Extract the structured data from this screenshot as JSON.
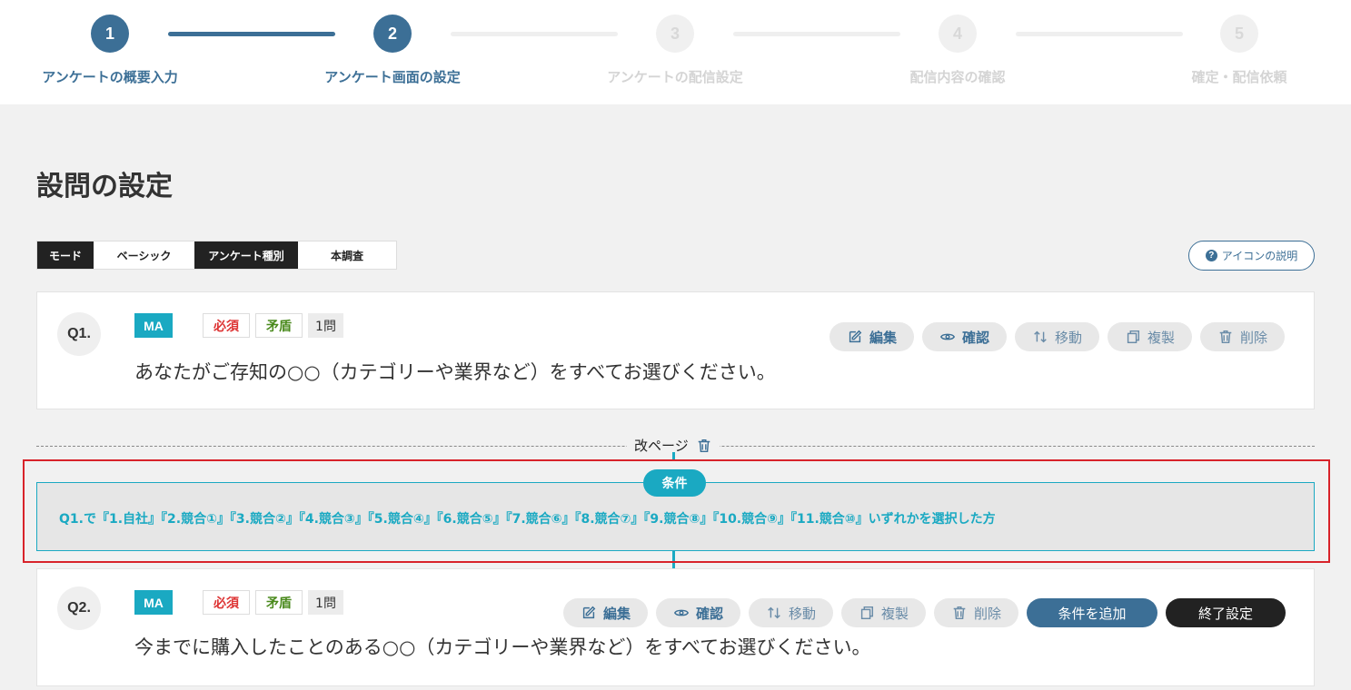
{
  "stepper": {
    "steps": [
      {
        "number": "1",
        "label": "アンケートの概要入力"
      },
      {
        "number": "2",
        "label": "アンケート画面の設定"
      },
      {
        "number": "3",
        "label": "アンケートの配信設定"
      },
      {
        "number": "4",
        "label": "配信内容の確認"
      },
      {
        "number": "5",
        "label": "確定・配信依頼"
      }
    ],
    "completed_steps": 2
  },
  "page_title": "設問の設定",
  "mode_bar": {
    "mode_label": "モード",
    "mode_value": "ベーシック",
    "survey_type_label": "アンケート種別",
    "survey_type_value": "本調査"
  },
  "help_button": {
    "label": "アイコンの説明",
    "icon": "question-circle-icon"
  },
  "actions": {
    "edit": "編集",
    "preview": "確認",
    "move": "移動",
    "copy": "複製",
    "delete": "削除",
    "add_condition": "条件を追加",
    "end_setting": "終了設定"
  },
  "questions": [
    {
      "number": "Q1.",
      "type": "MA",
      "required": "必須",
      "contradiction": "矛盾",
      "count": "1問",
      "text": "あなたがご存知の○○（カテゴリーや業界など）をすべてお選びください。"
    },
    {
      "number": "Q2.",
      "type": "MA",
      "required": "必須",
      "contradiction": "矛盾",
      "count": "1問",
      "text": "今までに購入したことのある○○（カテゴリーや業界など）をすべてお選びください。"
    }
  ],
  "page_break": {
    "label": "改ページ"
  },
  "condition": {
    "tag": "条件",
    "text": "Q1.で『1.自社』『2.競合①』『3.競合②』『4.競合③』『5.競合④』『6.競合⑤』『7.競合⑥』『8.競合⑦』『9.競合⑧』『10.競合⑨』『11.競合⑩』いずれかを選択した方"
  },
  "colors": {
    "primary": "#3c6f96",
    "teal": "#1aa9c2",
    "highlight": "#d8232a"
  }
}
